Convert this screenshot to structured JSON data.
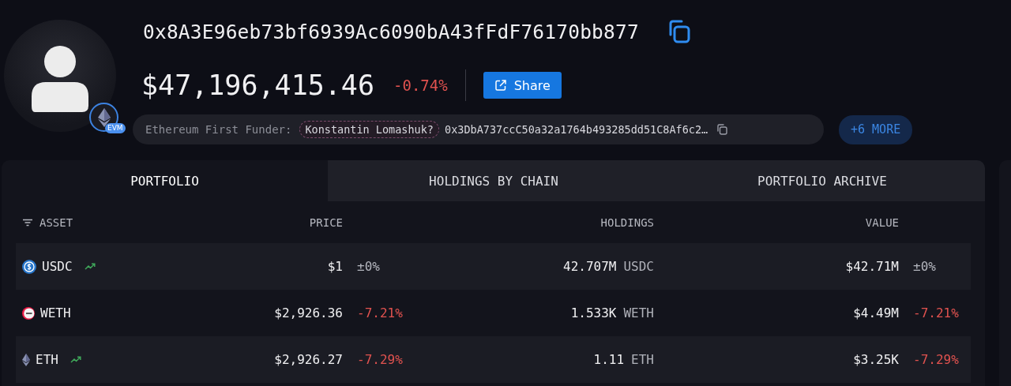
{
  "profile": {
    "address": "0x8A3E96eb73bf6939Ac6090bA43fFdF76170bb877",
    "chain_badge": "EVM",
    "balance": "$47,196,415.46",
    "change": "-0.74%",
    "share_button": "Share",
    "funder": {
      "label": "Ethereum First Funder:",
      "name": "Konstantin Lomashuk?",
      "address": "0x3DbA737ccC50a32a1764b493285dd51C8Af6c2…"
    },
    "more_button": "+6 MORE"
  },
  "tabs": [
    {
      "label": "PORTFOLIO",
      "selected": true
    },
    {
      "label": "HOLDINGS BY CHAIN",
      "selected": false
    },
    {
      "label": "PORTFOLIO ARCHIVE",
      "selected": false
    }
  ],
  "table": {
    "columns": [
      "ASSET",
      "PRICE",
      "HOLDINGS",
      "VALUE"
    ],
    "rows": [
      {
        "kind": "usdc",
        "asset": "USDC",
        "trending": true,
        "price": "$1",
        "price_change": "±0%",
        "color": "#b4b6be",
        "amount": "42.707M",
        "unit": "USDC",
        "value": "$42.71M",
        "value_change": "±0%"
      },
      {
        "kind": "weth",
        "asset": "WETH",
        "trending": false,
        "price": "$2,926.36",
        "price_change": "-7.21%",
        "color": "#e0524f",
        "amount": "1.533K",
        "unit": "WETH",
        "value": "$4.49M",
        "value_change": "-7.21%"
      },
      {
        "kind": "eth",
        "asset": "ETH",
        "trending": true,
        "price": "$2,926.27",
        "price_change": "-7.29%",
        "color": "#e0524f",
        "amount": "1.11",
        "unit": "ETH",
        "value": "$3.25K",
        "value_change": "-7.29%"
      }
    ]
  }
}
